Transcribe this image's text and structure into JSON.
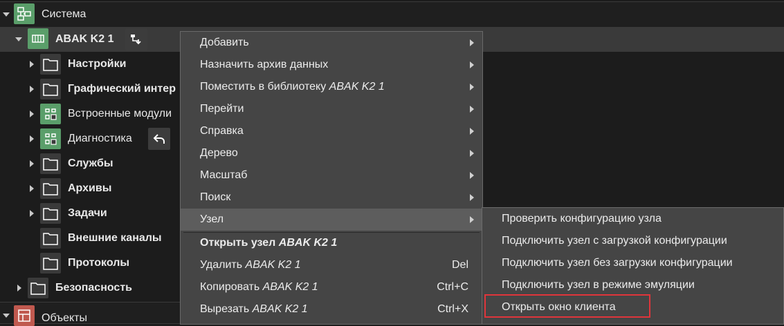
{
  "tree": {
    "system": {
      "label": "Система"
    },
    "node": {
      "label": "ABAK K2 1"
    },
    "items": [
      {
        "label": "Настройки",
        "bold": true
      },
      {
        "label": "Графический интер",
        "bold": true
      },
      {
        "label": "Встроенные модули",
        "bold": false
      },
      {
        "label": "Диагностика",
        "bold": false
      },
      {
        "label": "Службы",
        "bold": true
      },
      {
        "label": "Архивы",
        "bold": true
      },
      {
        "label": "Задачи",
        "bold": true
      },
      {
        "label": "Внешние каналы",
        "bold": true
      },
      {
        "label": "Протоколы",
        "bold": true
      }
    ],
    "security": {
      "label": "Безопасность"
    },
    "objects": {
      "label": "Объекты"
    }
  },
  "context_menu": {
    "items": [
      {
        "label": "Добавить"
      },
      {
        "label": "Назначить архив данных"
      },
      {
        "label": "Поместить в библиотеку",
        "italic": "ABAK K2 1"
      },
      {
        "label": "Перейти"
      },
      {
        "label": "Справка"
      },
      {
        "label": "Дерево"
      },
      {
        "label": "Масштаб"
      },
      {
        "label": "Поиск"
      },
      {
        "label": "Узел"
      }
    ],
    "open_node": {
      "label": "Открыть узел",
      "italic": "ABAK K2 1"
    },
    "delete": {
      "label": "Удалить",
      "italic": "ABAK K2 1",
      "shortcut": "Del"
    },
    "copy": {
      "label": "Копировать",
      "italic": "ABAK K2 1",
      "shortcut": "Ctrl+C"
    },
    "cut": {
      "label": "Вырезать",
      "italic": "ABAK K2 1",
      "shortcut": "Ctrl+X"
    }
  },
  "node_submenu": {
    "items": [
      {
        "label": "Проверить конфигурацию узла"
      },
      {
        "label": "Подключить узел с загрузкой конфигурации"
      },
      {
        "label": "Подключить узел без загрузки конфигурации"
      },
      {
        "label": "Подключить узел в режиме эмуляции"
      },
      {
        "label": "Открыть окно клиента"
      }
    ]
  },
  "colors": {
    "highlight_box": "#e0353b",
    "green_icon": "#5a9e6a",
    "red_icon": "#c0594f"
  }
}
